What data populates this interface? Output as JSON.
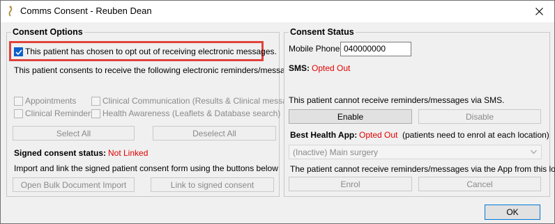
{
  "window": {
    "title": "Comms Consent - Reuben Dean",
    "app_icon": "app-logo-icon",
    "close_icon": "close-icon"
  },
  "consent_options": {
    "title": "Consent Options",
    "opt_out_label": "This patient has chosen to opt out of receiving electronic messages.",
    "opt_out_checked": true,
    "consent_text": "This patient consents to receive the following electronic reminders/messages",
    "checkboxes": [
      {
        "label": "Appointments",
        "checked": false
      },
      {
        "label": "Clinical Communication (Results & Clinical messages)",
        "checked": false
      },
      {
        "label": "Clinical Reminders",
        "checked": false
      },
      {
        "label": "Health Awareness (Leaflets & Database search)",
        "checked": false
      }
    ],
    "select_all": "Select All",
    "deselect_all": "Deselect All",
    "signed_status_label": "Signed consent status:",
    "signed_status_value": "Not Linked",
    "import_text": "Import and link the signed patient consent form using the buttons below",
    "bulk_import": "Open Bulk Document Import",
    "link_signed": "Link to signed consent"
  },
  "consent_status": {
    "title": "Consent Status",
    "mobile_label": "Mobile Phone:",
    "mobile_value": "040000000",
    "sms_label": "SMS:",
    "sms_status": "Opted Out",
    "sms_message": "This patient cannot receive reminders/messages via SMS.",
    "enable": "Enable",
    "disable": "Disable",
    "app_label": "Best Health App:",
    "app_status": "Opted Out",
    "app_note": "(patients need to enrol at each location)",
    "location_selected": "(Inactive) Main surgery",
    "app_message": "The patient cannot receive reminders/messages via the App from this location.",
    "enrol": "Enrol",
    "cancel": "Cancel"
  },
  "footer": {
    "ok": "OK"
  },
  "colors": {
    "highlight": "#e0433c",
    "status_red": "#e00000",
    "accent": "#0a60c9"
  }
}
